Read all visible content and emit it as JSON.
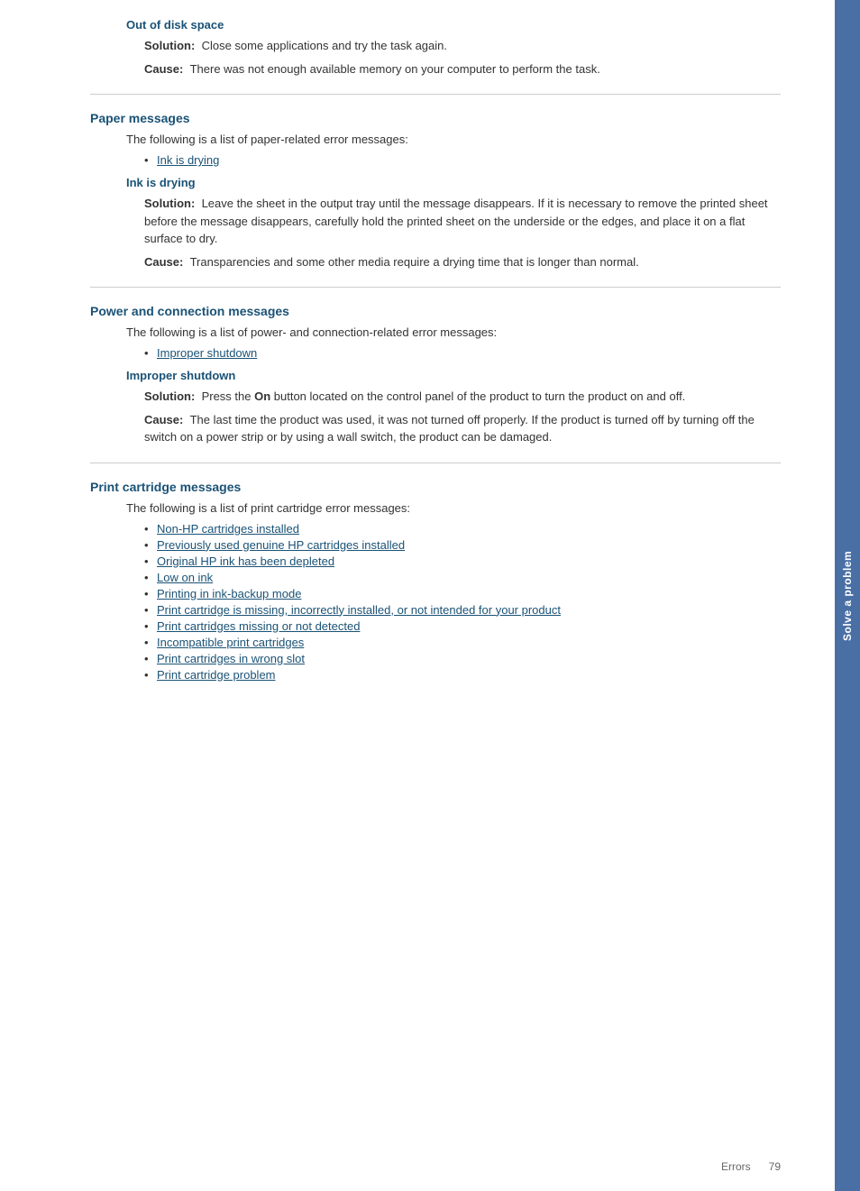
{
  "sidebar": {
    "label": "Solve a problem"
  },
  "top_section": {
    "heading": "Out of disk space",
    "solution_label": "Solution:",
    "solution_text": "Close some applications and try the task again.",
    "cause_label": "Cause:",
    "cause_text": "There was not enough available memory on your computer to perform the task."
  },
  "paper_messages": {
    "heading": "Paper messages",
    "intro": "The following is a list of paper-related error messages:",
    "links": [
      {
        "text": "Ink is drying"
      }
    ],
    "ink_drying": {
      "heading": "Ink is drying",
      "solution_label": "Solution:",
      "solution_text": "Leave the sheet in the output tray until the message disappears. If it is necessary to remove the printed sheet before the message disappears, carefully hold the printed sheet on the underside or the edges, and place it on a flat surface to dry.",
      "cause_label": "Cause:",
      "cause_text": "Transparencies and some other media require a drying time that is longer than normal."
    }
  },
  "power_messages": {
    "heading": "Power and connection messages",
    "intro": "The following is a list of power- and connection-related error messages:",
    "links": [
      {
        "text": "Improper shutdown"
      }
    ],
    "improper_shutdown": {
      "heading": "Improper shutdown",
      "solution_label": "Solution:",
      "solution_text_prefix": "Press the ",
      "solution_bold": "On",
      "solution_text_suffix": " button located on the control panel of the product to turn the product on and off.",
      "cause_label": "Cause:",
      "cause_text": "The last time the product was used, it was not turned off properly. If the product is turned off by turning off the switch on a power strip or by using a wall switch, the product can be damaged."
    }
  },
  "cartridge_messages": {
    "heading": "Print cartridge messages",
    "intro": "The following is a list of print cartridge error messages:",
    "links": [
      {
        "text": "Non-HP cartridges installed"
      },
      {
        "text": "Previously used genuine HP cartridges installed"
      },
      {
        "text": "Original HP ink has been depleted"
      },
      {
        "text": "Low on ink"
      },
      {
        "text": "Printing in ink-backup mode"
      },
      {
        "text": "Print cartridge is missing, incorrectly installed, or not intended for your product"
      },
      {
        "text": "Print cartridges missing or not detected"
      },
      {
        "text": "Incompatible print cartridges"
      },
      {
        "text": "Print cartridges in wrong slot"
      },
      {
        "text": "Print cartridge problem"
      }
    ]
  },
  "footer": {
    "errors_label": "Errors",
    "page_number": "79"
  }
}
